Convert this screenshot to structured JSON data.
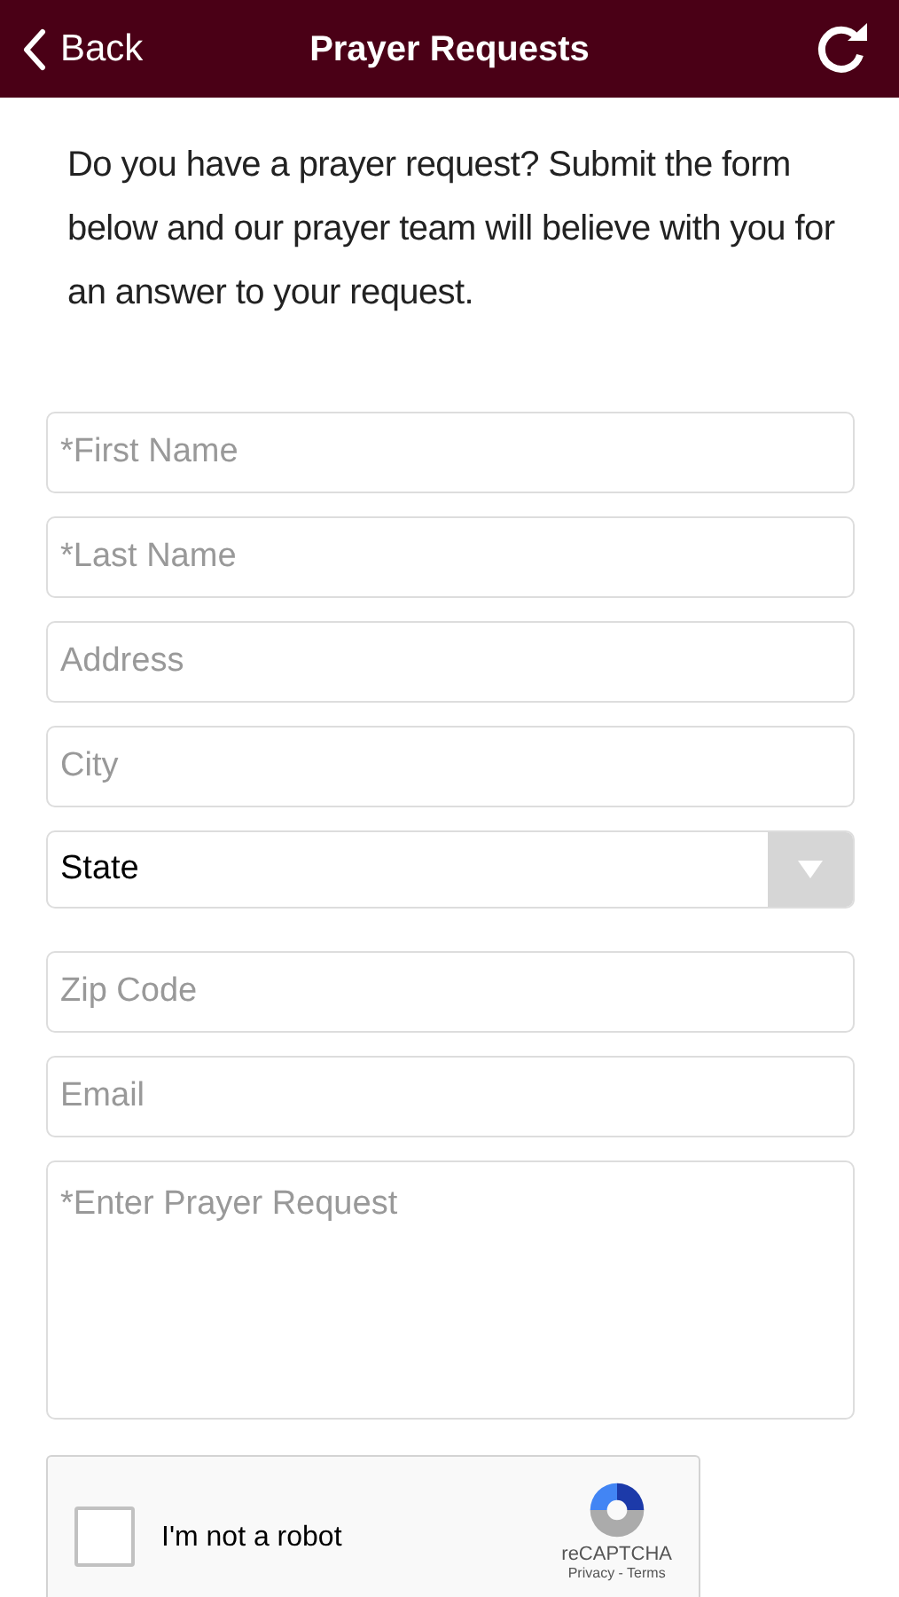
{
  "header": {
    "back_label": "Back",
    "title": "Prayer Requests"
  },
  "intro": "Do you have a prayer request? Submit the form below and our prayer team will believe with you for an answer to your request.",
  "fields": [
    {
      "kind": "input",
      "placeholder": "*First Name"
    },
    {
      "kind": "input",
      "placeholder": "*Last Name"
    },
    {
      "kind": "input",
      "placeholder": "Address"
    },
    {
      "kind": "input",
      "placeholder": "City"
    },
    {
      "kind": "select",
      "value": "State"
    },
    {
      "kind": "input",
      "placeholder": "Zip Code"
    },
    {
      "kind": "input",
      "placeholder": "Email"
    },
    {
      "kind": "textarea",
      "placeholder": "*Enter Prayer Request"
    }
  ],
  "captcha": {
    "label": "I'm not a robot",
    "checked": false,
    "brand": "reCAPTCHA",
    "links": "Privacy - Terms"
  }
}
